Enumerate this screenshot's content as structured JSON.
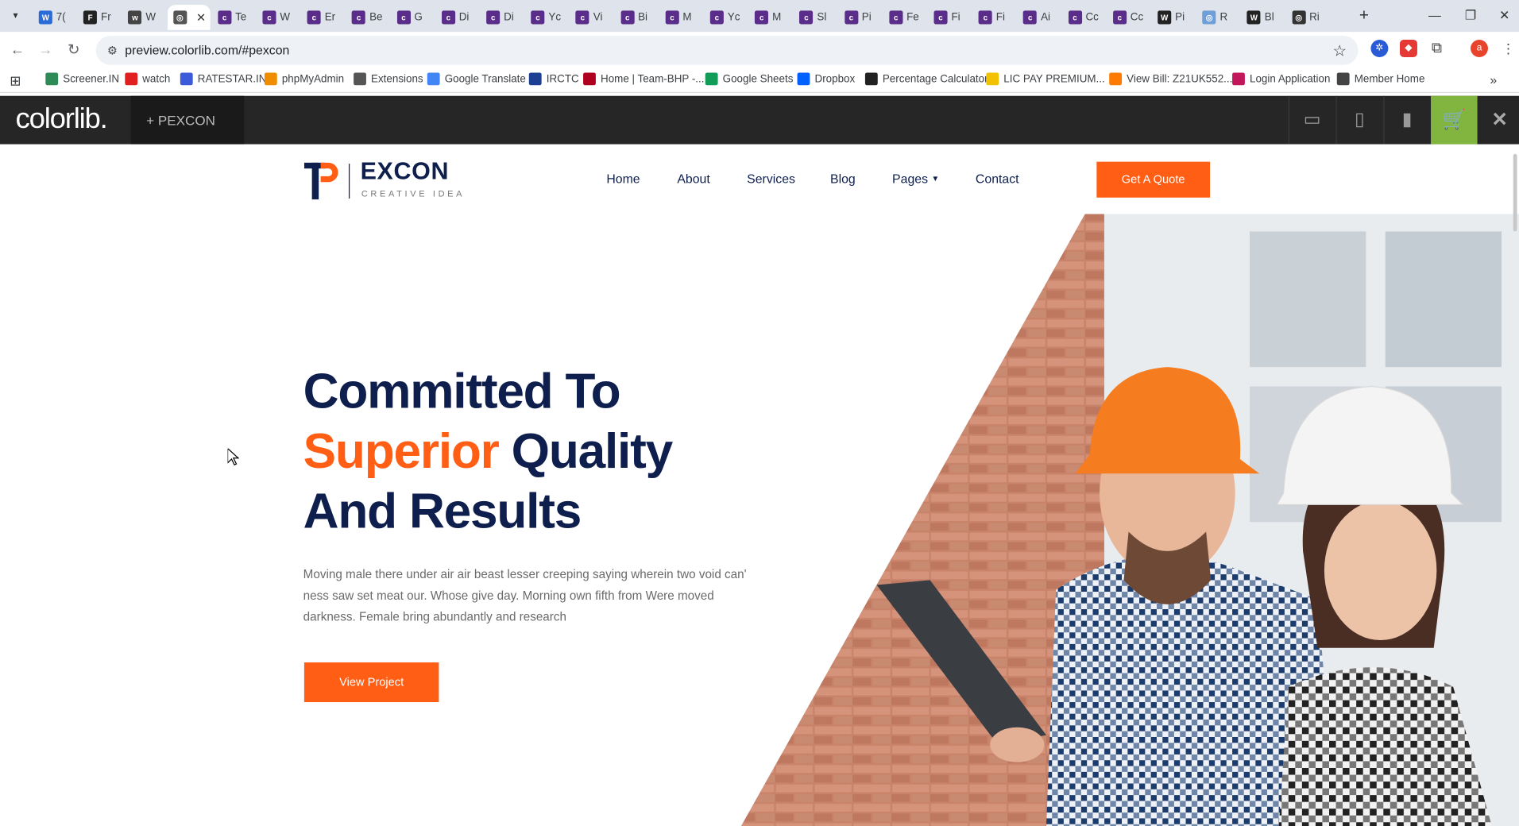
{
  "browser": {
    "tabs": [
      {
        "label": "7(",
        "icon": "W",
        "color": "#2a6bd8"
      },
      {
        "label": "Fr",
        "icon": "F",
        "color": "#222222"
      },
      {
        "label": "W",
        "icon": "wix",
        "color": "#444444"
      },
      {
        "label": "",
        "icon": "globe",
        "color": "#555555",
        "active": true
      },
      {
        "label": "Te",
        "icon": "c",
        "color": "#5b2d8a"
      },
      {
        "label": "W",
        "icon": "c",
        "color": "#5b2d8a"
      },
      {
        "label": "Er",
        "icon": "c",
        "color": "#5b2d8a"
      },
      {
        "label": "Be",
        "icon": "c",
        "color": "#5b2d8a"
      },
      {
        "label": "G",
        "icon": "c",
        "color": "#5b2d8a"
      },
      {
        "label": "Di",
        "icon": "c",
        "color": "#5b2d8a"
      },
      {
        "label": "Di",
        "icon": "c",
        "color": "#5b2d8a"
      },
      {
        "label": "Yc",
        "icon": "c",
        "color": "#5b2d8a"
      },
      {
        "label": "Vi",
        "icon": "c",
        "color": "#5b2d8a"
      },
      {
        "label": "Bi",
        "icon": "c",
        "color": "#5b2d8a"
      },
      {
        "label": "M",
        "icon": "c",
        "color": "#5b2d8a"
      },
      {
        "label": "Yc",
        "icon": "c",
        "color": "#5b2d8a"
      },
      {
        "label": "M",
        "icon": "c",
        "color": "#5b2d8a"
      },
      {
        "label": "Sl",
        "icon": "c",
        "color": "#5b2d8a"
      },
      {
        "label": "Pi",
        "icon": "c",
        "color": "#5b2d8a"
      },
      {
        "label": "Fe",
        "icon": "c",
        "color": "#5b2d8a"
      },
      {
        "label": "Fi",
        "icon": "c",
        "color": "#5b2d8a"
      },
      {
        "label": "Fi",
        "icon": "c",
        "color": "#5b2d8a"
      },
      {
        "label": "Ai",
        "icon": "c",
        "color": "#5b2d8a"
      },
      {
        "label": "Cc",
        "icon": "c",
        "color": "#5b2d8a"
      },
      {
        "label": "Cc",
        "icon": "c",
        "color": "#5b2d8a"
      },
      {
        "label": "Pi",
        "icon": "W",
        "color": "#222222"
      },
      {
        "label": "R",
        "icon": "globe",
        "color": "#6f9fd8"
      },
      {
        "label": "Bl",
        "icon": "W",
        "color": "#222222"
      },
      {
        "label": "Ri",
        "icon": "globe",
        "color": "#333333"
      }
    ],
    "tab_close_glyph": "✕",
    "new_tab_glyph": "+",
    "url": "preview.colorlib.com/#pexcon",
    "profile_initial": "a"
  },
  "bookmarks": [
    {
      "label": "Screener.IN",
      "color": "#2e8b57"
    },
    {
      "label": "watch",
      "color": "#e02020"
    },
    {
      "label": "RATESTAR.IN",
      "color": "#3b5bdb"
    },
    {
      "label": "phpMyAdmin",
      "color": "#f08c00"
    },
    {
      "label": "Extensions",
      "color": "#555555"
    },
    {
      "label": "Google Translate",
      "color": "#4285f4"
    },
    {
      "label": "IRCTC",
      "color": "#1c3f94"
    },
    {
      "label": "Home | Team-BHP -...",
      "color": "#b00020"
    },
    {
      "label": "Google Sheets",
      "color": "#0f9d58"
    },
    {
      "label": "Dropbox",
      "color": "#0061fe"
    },
    {
      "label": "Percentage Calculator",
      "color": "#222222"
    },
    {
      "label": "LIC PAY PREMIUM...",
      "color": "#f2c200"
    },
    {
      "label": "View Bill: Z21UK552...",
      "color": "#ff7a00"
    },
    {
      "label": "Login Application",
      "color": "#c2185b"
    },
    {
      "label": "Member Home",
      "color": "#444444"
    }
  ],
  "colorlib": {
    "logo": "colorlib.",
    "project_label": "+   PEXCON"
  },
  "site": {
    "brand_name": "EXCON",
    "brand_tagline": "CREATIVE IDEA",
    "nav": [
      "Home",
      "About",
      "Services",
      "Blog",
      "Pages",
      "Contact"
    ],
    "quote_button": "Get A Quote",
    "headline_line1": "Committed To",
    "headline_line2_accent": "Superior",
    "headline_line2_rest": " Quality",
    "headline_line3": "And Results",
    "paragraph": "Moving male there under air air beast lesser creeping saying wherein two void can' ness saw set meat our. Whose give day. Morning own fifth from Were moved darkness. Female bring abundantly and research",
    "cta_button": "View Project",
    "accent_color": "#ff5e14",
    "navy_color": "#0e1f4e"
  }
}
